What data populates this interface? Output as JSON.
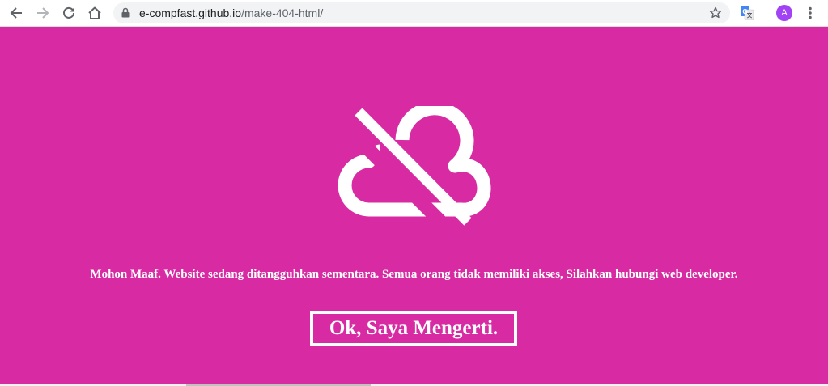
{
  "browser": {
    "url_host": "e-compfast.github.io",
    "url_path": "/make-404-html/",
    "profile_initial": "A",
    "icons": {
      "back": "arrow-left-icon",
      "forward": "arrow-right-icon",
      "reload": "reload-icon",
      "home": "home-icon",
      "lock": "lock-icon",
      "bookmark": "star-icon",
      "translate": "translate-icon",
      "menu": "more-vert-icon"
    }
  },
  "page": {
    "background_color": "#d82ba3",
    "icon": "cloud-off-icon",
    "message": "Mohon Maaf. Website sedang ditangguhkan sementara. Semua orang tidak memiliki akses, Silahkan hubungi web developer.",
    "button_label": "Ok, Saya Mengerti."
  },
  "colors": {
    "accent": "#d82ba3",
    "avatar": "#a142f4",
    "text_on_accent": "#ffffff"
  }
}
